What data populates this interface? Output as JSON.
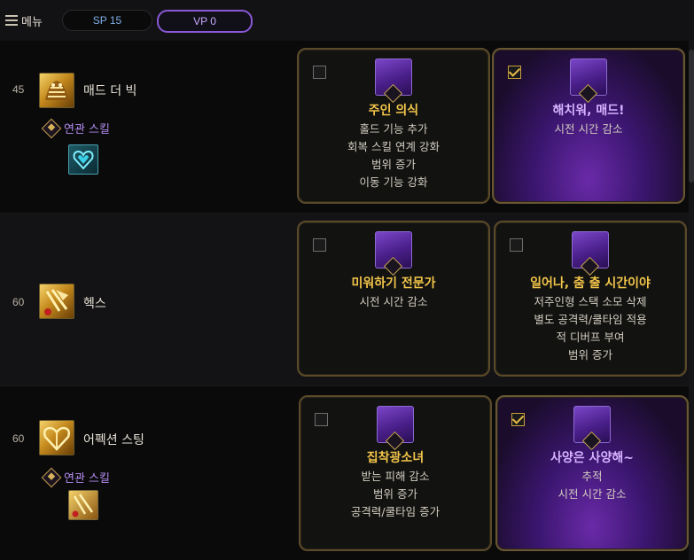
{
  "topbar": {
    "menu_label": "메뉴",
    "sp_label": "SP 15",
    "vp_label": "VP 0"
  },
  "related_label": "연관 스킬",
  "rows": [
    {
      "level": "45",
      "skill_name": "매드 더 빅",
      "has_related": true,
      "cards": [
        {
          "checked": false,
          "selected": false,
          "tier": "I",
          "title": "주인 의식",
          "desc": [
            "홀드 기능 추가",
            "회복 스킬 연계 강화",
            "범위 증가",
            "이동 기능 강화"
          ]
        },
        {
          "checked": true,
          "selected": true,
          "tier": "II",
          "title": "해치워, 매드!",
          "desc": [
            "시전 시간 감소"
          ]
        }
      ]
    },
    {
      "level": "60",
      "skill_name": "헥스",
      "has_related": false,
      "cards": [
        {
          "checked": false,
          "selected": false,
          "tier": "I",
          "title": "미워하기 전문가",
          "desc": [
            "시전 시간 감소"
          ]
        },
        {
          "checked": false,
          "selected": false,
          "tier": "II",
          "title": "일어나, 춤 출 시간이야",
          "desc": [
            "저주인형 스택 소모 삭제",
            "별도 공격력/쿨타임 적용",
            "적 디버프 부여",
            "범위 증가"
          ]
        }
      ]
    },
    {
      "level": "60",
      "skill_name": "어펙션 스팅",
      "has_related": true,
      "cards": [
        {
          "checked": false,
          "selected": false,
          "tier": "I",
          "title": "집착광소녀",
          "desc": [
            "받는 피해 감소",
            "범위 증가",
            "공격력/쿨타임 증가"
          ]
        },
        {
          "checked": true,
          "selected": true,
          "tier": "II",
          "title": "사양은 사양해~",
          "desc": [
            "추적",
            "시전 시간 감소"
          ]
        }
      ]
    }
  ],
  "colors": {
    "gold_title": "#f2c54a",
    "purple_title": "#d8b2ff",
    "related_text": "#b48cf0",
    "vp_border": "#8a58d6"
  }
}
